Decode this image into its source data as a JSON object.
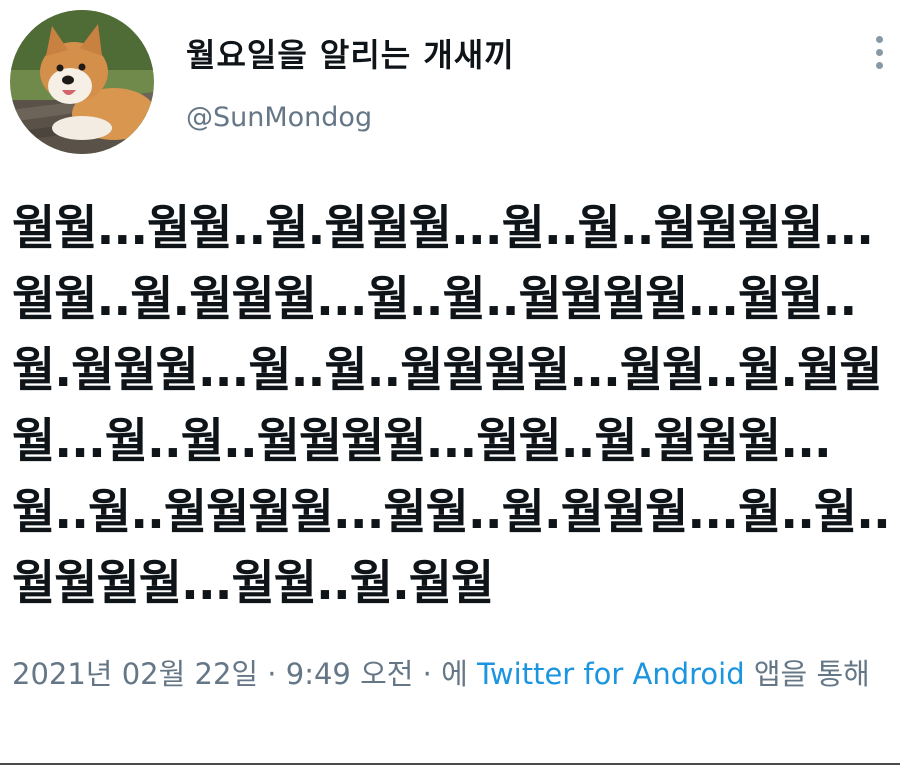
{
  "tweet": {
    "author": {
      "display_name": "월요일을 알리는 개새끼",
      "handle": "@SunMondog",
      "avatar_icon": "akita-dog-avatar"
    },
    "text": "월월...월월..월.월월월...월..월..월월월월...월월..월.월월월...월..월..월월월월...월월..월.월월월...월..월..월월월월...월월..월.월월월...월..월..월월월월...월월..월.월월월...월..월..월월월월...월월..월.월월월...월..월..월월월월...월월..월.월월",
    "timestamp": "2021년 02월 22일 · 9:49 오전",
    "via_prefix": " · 에 ",
    "source": "Twitter for Android",
    "via_suffix": " 앱을 통해",
    "menu_icon": "more-vertical-icon"
  },
  "colors": {
    "text": "#0f1419",
    "secondary": "#657786",
    "link": "#1b95e0"
  }
}
